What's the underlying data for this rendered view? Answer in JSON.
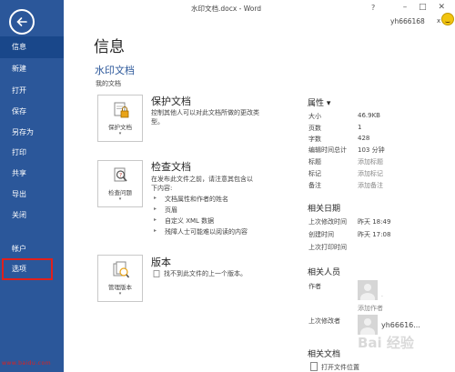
{
  "window": {
    "title": "水印文档.docx - Word",
    "help": "?",
    "controls": "–  □  ✕",
    "user": "yh666168",
    "user_caret": "x"
  },
  "sidebar": {
    "items": [
      {
        "label": "信息"
      },
      {
        "label": "新建"
      },
      {
        "label": "打开"
      },
      {
        "label": "保存"
      },
      {
        "label": "另存为"
      },
      {
        "label": "打印"
      },
      {
        "label": "共享"
      },
      {
        "label": "导出"
      },
      {
        "label": "关闭"
      },
      {
        "label": "帐户"
      },
      {
        "label": "选项"
      }
    ],
    "footer_text": "www.baidu.com"
  },
  "info": {
    "page_title": "信息",
    "doc_title": "水印文档",
    "doc_path": "我的文档"
  },
  "protect": {
    "tile_label": "保护文档",
    "caret": "▾",
    "title": "保护文档",
    "desc": [
      "控制其他人可以对此文档所做的更改类",
      "型。"
    ]
  },
  "inspect": {
    "tile_label": "检查问题",
    "caret": "▾",
    "title": "检查文档",
    "desc": [
      "在发布此文件之前，请注意其包含以",
      "下内容:"
    ],
    "bullets": [
      "文档属性和作者的姓名",
      "页眉",
      "自定义 XML 数据",
      "残障人士可能难以阅读的内容"
    ]
  },
  "versions": {
    "tile_label": "管理版本",
    "caret": "▾",
    "title": "版本",
    "desc": "找不到此文件的上一个版本。"
  },
  "properties": {
    "header": "属性 ▾",
    "rows": [
      {
        "label": "大小",
        "value": "46.9KB"
      },
      {
        "label": "页数",
        "value": "1"
      },
      {
        "label": "字数",
        "value": "428"
      },
      {
        "label": "编辑时间总计",
        "value": "103 分钟"
      },
      {
        "label": "标题",
        "value": "添加标题"
      },
      {
        "label": "标记",
        "value": "添加标记"
      },
      {
        "label": "备注",
        "value": "添加备注"
      }
    ],
    "dates_header": "相关日期",
    "dates": [
      {
        "label": "上次修改时间",
        "value": "昨天 18:49"
      },
      {
        "label": "创建时间",
        "value": "昨天 17:08"
      },
      {
        "label": "上次打印时间",
        "value": ""
      }
    ],
    "people_header": "相关人员",
    "author_label": "作者",
    "add_author": "添加作者",
    "last_modified_label": "上次修改者",
    "last_modified_name": "yh66616...",
    "docs_header": "相关文档",
    "open_location": "打开文件位置",
    "watermark": "Bai 经验"
  },
  "colors": {
    "sidebar": "#2b579a",
    "sidebar_active": "#19478a",
    "highlight": "#e0201c",
    "accent_text": "#2b579a"
  }
}
